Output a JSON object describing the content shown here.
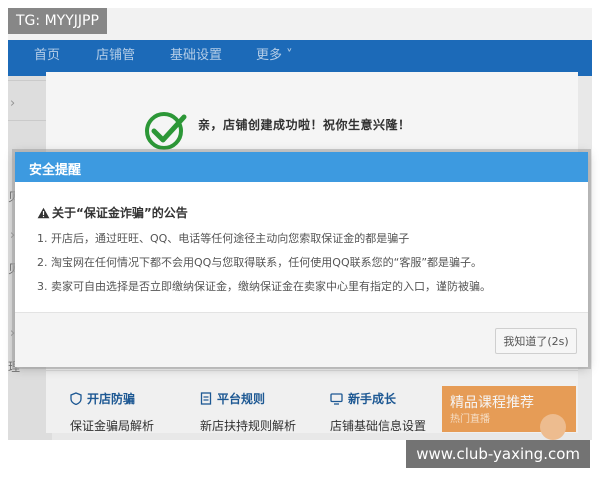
{
  "watermark_top": "TG: MYYJJPP",
  "watermark_bottom": "www.club-yaxing.com",
  "nav": {
    "items": [
      "首页",
      "店铺管",
      "基础设置",
      "更多 ˅"
    ]
  },
  "leftbar": {
    "labels": [
      "贝",
      "贝",
      "理"
    ]
  },
  "success_message": "亲，店铺创建成功啦！祝你生意兴隆！",
  "modal": {
    "title": "安全提醒",
    "notice_title": "关于“保证金诈骗”的公告",
    "lines": [
      "1. 开店后，通过旺旺、QQ、电话等任何途径主动向您索取保证金的都是骗子",
      "2. 淘宝网在任何情况下都不会用QQ与您取得联系，任何使用QQ联系您的“客服”都是骗子。",
      "3. 卖家可自由选择是否立即缴纳保证金，缴纳保证金在卖家中心里有指定的入口，谨防被骗。"
    ],
    "ok_label": "我知道了(2s)"
  },
  "links": [
    {
      "head": "开店防骗",
      "sub": "保证金骗局解析",
      "icon": "shield-icon"
    },
    {
      "head": "平台规则",
      "sub": "新店扶持规则解析",
      "icon": "document-icon"
    },
    {
      "head": "新手成长",
      "sub": "店铺基础信息设置",
      "icon": "monitor-icon"
    }
  ],
  "promo": {
    "title": "精品课程推荐",
    "subtitle": "热门直播"
  },
  "colors": {
    "nav_blue": "#1e6fc0",
    "modal_header": "#3d9ae0",
    "success_green": "#2e9e3a",
    "promo_orange": "#f0a35a"
  }
}
